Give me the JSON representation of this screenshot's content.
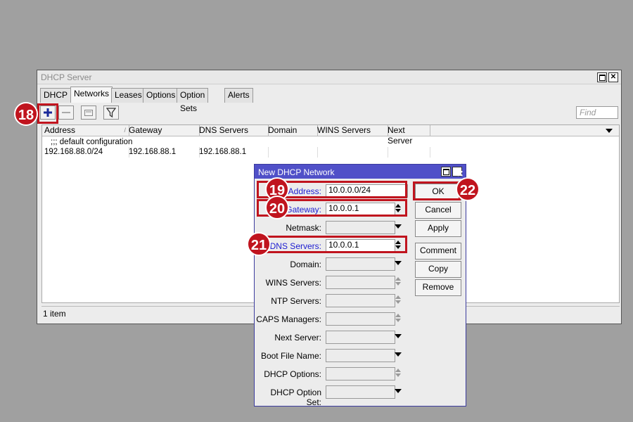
{
  "main_window": {
    "title": "DHCP Server",
    "tabs": [
      {
        "label": "DHCP"
      },
      {
        "label": "Networks"
      },
      {
        "label": "Leases"
      },
      {
        "label": "Options"
      },
      {
        "label": "Option Sets"
      },
      {
        "label": "Alerts"
      }
    ],
    "active_tab": "Networks",
    "find_placeholder": "Find",
    "columns": [
      "Address",
      "Gateway",
      "DNS Servers",
      "Domain",
      "WINS Servers",
      "Next Server"
    ],
    "comment_row": ";;; default configuration",
    "rows": [
      {
        "address": "192.168.88.0/24",
        "gateway": "192.168.88.1",
        "dns": "192.168.88.1",
        "domain": "",
        "wins": "",
        "next_server": ""
      }
    ],
    "status": "1 item"
  },
  "dialog": {
    "title": "New DHCP Network",
    "fields": [
      {
        "label": "Address:",
        "value": "10.0.0.0/24"
      },
      {
        "label": "Gateway:",
        "value": "10.0.0.1"
      },
      {
        "label": "Netmask:",
        "value": ""
      },
      {
        "label": "DNS Servers:",
        "value": "10.0.0.1"
      },
      {
        "label": "Domain:",
        "value": ""
      },
      {
        "label": "WINS Servers:",
        "value": ""
      },
      {
        "label": "NTP Servers:",
        "value": ""
      },
      {
        "label": "CAPS Managers:",
        "value": ""
      },
      {
        "label": "Next Server:",
        "value": ""
      },
      {
        "label": "Boot File Name:",
        "value": ""
      },
      {
        "label": "DHCP Options:",
        "value": ""
      },
      {
        "label": "DHCP Option Set:",
        "value": ""
      }
    ],
    "buttons": {
      "ok": "OK",
      "cancel": "Cancel",
      "apply": "Apply",
      "comment": "Comment",
      "copy": "Copy",
      "remove": "Remove"
    }
  },
  "annotations": {
    "step_18": "18",
    "step_19": "19",
    "step_20": "20",
    "step_21": "21",
    "step_22": "22",
    "highlight_color": "#c0141e"
  },
  "colors": {
    "dialog_title_bar": "#5050c8",
    "label_highlight": "#1c1cd0",
    "add_icon": "#1a2a9a"
  }
}
